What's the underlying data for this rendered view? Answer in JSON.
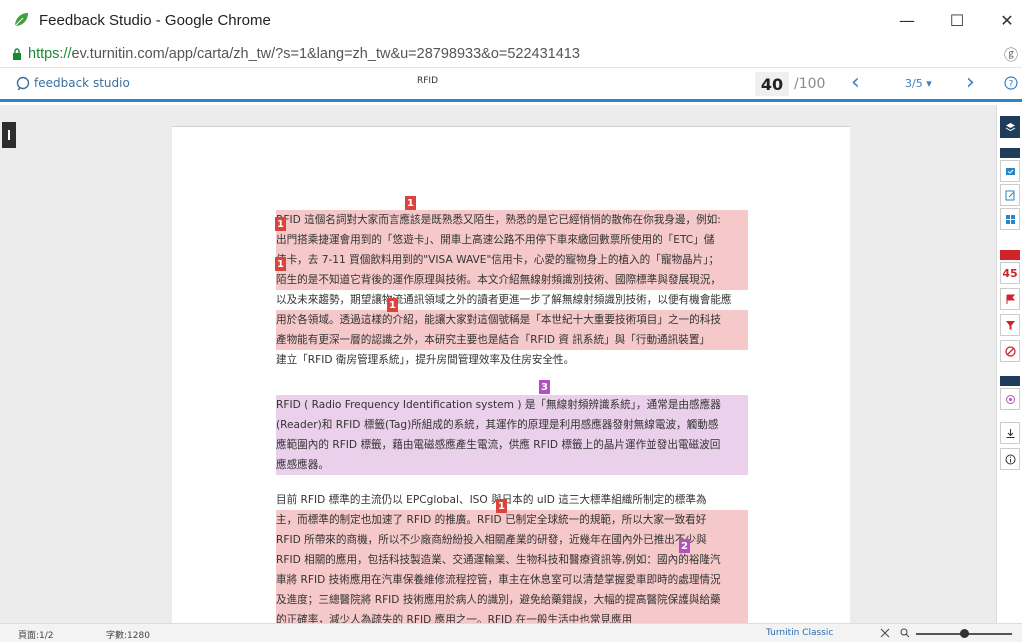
{
  "window": {
    "title": "Feedback Studio - Google Chrome",
    "minimize": "—",
    "maximize": "☐",
    "close": "✕"
  },
  "address": {
    "scheme": "https://",
    "url_rest": "ev.turnitin.com/app/carta/zh_tw/?s=1&lang=zh_tw&u=28798933&o=522431413",
    "key_icon": "ⓖ"
  },
  "header": {
    "brand": "feedback studio",
    "doc_title": "RFID",
    "score": "40",
    "score_max": "/100",
    "prev": "‹",
    "next": "›",
    "pager": "3/5 ▾"
  },
  "document": {
    "paragraph1": [
      "RFID 這個名詞對大家而言應該是既熟悉又陌生，熟悉的是它已經悄悄的散佈在你我身邊，例如:",
      "出門搭乘捷運會用到的「悠遊卡」、開車上高速公路不用停下車來繳回數票所使用的「ETC」儲",
      "值卡，去 7-11 買個飲料用到的\"VISA WAVE\"信用卡，心愛的寵物身上的植入的「寵物晶片」；",
      "陌生的是不知道它背後的運作原理與技術。本文介紹無線射頻識別技術、國際標準與發展現況，",
      "以及未來趨勢，期望讓物流通訊領域之外的讀者更進一步了解無線射頻識別技術，以便有機會能應",
      "用於各領域。透過這樣的介紹，能讓大家對這個號稱是「本世紀十大重要技術項目」之一的科技",
      "產物能有更深一層的認識之外，本研究主要也是結合「RFID 資 訊系統」與「行動通訊裝置」",
      "建立「RFID 衛房管理系統」，提升房間管理效率及住房安全性。"
    ],
    "paragraph2": [
      "RFID ( Radio Frequency Identification system ) 是「無線射頻辨識系統」，通常是由感應器",
      "(Reader)和 RFID 標籤(Tag)所組成的系統，其運作的原理是利用感應器發射無線電波，觸動感",
      "應範圍內的 RFID 標籤，藉由電磁感應產生電流，供應 RFID 標籤上的晶片運作並發出電磁波回",
      "應感應器。"
    ],
    "paragraph3": [
      "目前 RFID 標準的主流仍以 EPCglobal、ISO 與日本的 uID 這三大標準組織所制定的標準為",
      "主，而標準的制定也加速了 RFID 的推廣。RFID 已制定全球統一的規範，所以大家一致看好",
      "RFID 所帶來的商機，所以不少廠商紛紛投入相關產業的研發，近幾年在國內外已推出不少與",
      "RFID 相關的應用，包括科技製造業、交通運輸業、生物科技和醫療資訊等,例如：國內的裕隆汽",
      "車將 RFID 技術應用在汽車保養維修流程控管，車主在休息室可以清楚掌握愛車即時的處理情況",
      "及進度；三總醫院將 RFID 技術應用於病人的識別，避免給藥錯誤，大幅的提高醫院保護與給藥",
      "的正確率，減少人為疏失的 RFID 應用之一。RFID 在一般生活中也常見應用"
    ],
    "markers": {
      "m1": "1",
      "m2": "1",
      "m3": "1",
      "m4": "1",
      "m5": "3",
      "m6": "1",
      "m7": "2"
    }
  },
  "rail": {
    "similarity_count": "45"
  },
  "status": {
    "page": "頁面:1/2",
    "words": "字數:1280",
    "classic": "Turnitin Classic"
  }
}
